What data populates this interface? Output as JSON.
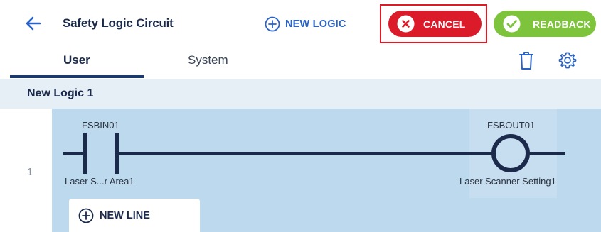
{
  "header": {
    "title": "Safety Logic Circuit",
    "new_logic_label": "NEW LOGIC",
    "cancel_label": "CANCEL",
    "readback_label": "READBACK"
  },
  "tabs": [
    {
      "label": "User",
      "active": true
    },
    {
      "label": "System",
      "active": false
    }
  ],
  "logic": {
    "name": "New Logic 1",
    "rungs": [
      {
        "number": "1",
        "input": {
          "tag": "FSBIN01",
          "description": "Laser S...r Area1"
        },
        "output": {
          "tag": "FSBOUT01",
          "description": "Laser Scanner Setting1"
        }
      }
    ],
    "new_line_label": "NEW LINE"
  },
  "colors": {
    "accent_blue": "#2a63c6",
    "cancel_red": "#db1a2a",
    "readback_green": "#7dc43c",
    "canvas": "#bcd9ee",
    "navy": "#1b2a4a",
    "highlight_frame": "#e01923"
  },
  "icons": [
    "back-arrow-icon",
    "plus-circle-icon",
    "close-circle-icon",
    "check-circle-icon",
    "trash-icon",
    "gear-icon",
    "contact-icon",
    "coil-icon"
  ]
}
